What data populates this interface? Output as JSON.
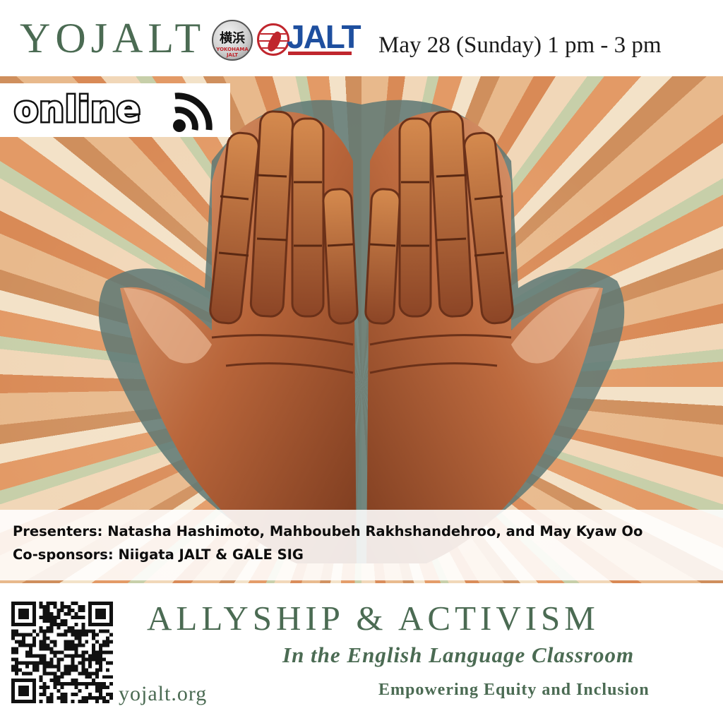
{
  "header": {
    "brand": "YOJALT",
    "partner_logos": {
      "yokohama": {
        "kanji": "横浜",
        "sub": "YOKOHAMA JALT"
      },
      "jalt": {
        "word": "JALT"
      }
    },
    "event_datetime": "May 28 (Sunday) 1 pm - 3 pm"
  },
  "banner": {
    "format_label": "online",
    "format_icon": "wifi-signal-icon"
  },
  "credits": {
    "presenters": "Presenters: Natasha Hashimoto, Mahboubeh Rakhshandehroo, and May Kyaw Oo",
    "cosponsors": "Co-sponsors: Niigata JALT & GALE SIG"
  },
  "footer": {
    "title": "ALLYSHIP & ACTIVISM",
    "subtitle": "In the English Language Classroom",
    "tagline": "Empowering Equity and Inclusion",
    "website": "yojalt.org"
  },
  "colors": {
    "brand_green": "#4b6b53",
    "jalt_blue": "#1e4f9f",
    "jalt_red": "#c0262d",
    "copper": "#b8653a"
  }
}
